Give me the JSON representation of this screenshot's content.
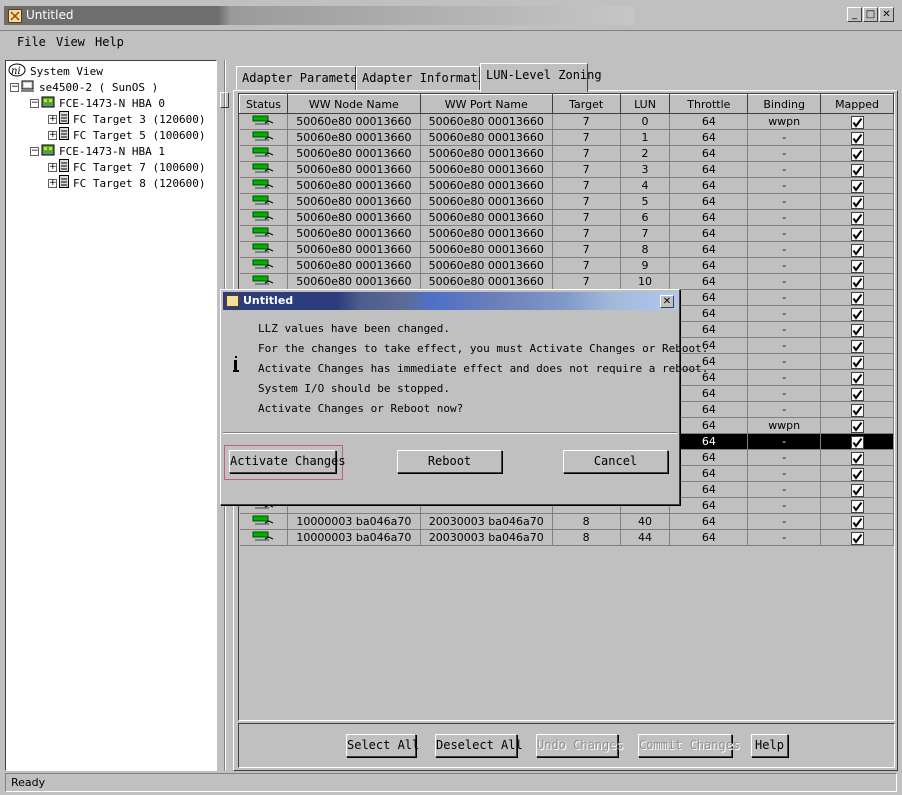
{
  "window": {
    "title": "Untitled"
  },
  "menubar": {
    "items": [
      "File",
      "View",
      "Help"
    ]
  },
  "tree": {
    "root": "System View",
    "host": "se4500-2 ( SunOS )",
    "hba0": "FCE-1473-N HBA 0",
    "hba0_targets": [
      "FC Target 3 (120600)",
      "FC Target 5 (100600)"
    ],
    "hba1": "FCE-1473-N HBA 1",
    "hba1_targets": [
      "FC Target 7 (100600)",
      "FC Target 8 (120600)"
    ]
  },
  "tabs": [
    "Adapter Parameters",
    "Adapter Information",
    "LUN-Level Zoning"
  ],
  "table": {
    "columns": [
      "Status",
      "WW Node Name",
      "WW Port Name",
      "Target",
      "LUN",
      "Throttle",
      "Binding",
      "Mapped"
    ],
    "rows": [
      [
        "",
        "50060e80 00013660",
        "50060e80 00013660",
        "7",
        "0",
        "64",
        "wwpn",
        ""
      ],
      [
        "",
        "50060e80 00013660",
        "50060e80 00013660",
        "7",
        "1",
        "64",
        "-",
        ""
      ],
      [
        "",
        "50060e80 00013660",
        "50060e80 00013660",
        "7",
        "2",
        "64",
        "-",
        ""
      ],
      [
        "",
        "50060e80 00013660",
        "50060e80 00013660",
        "7",
        "3",
        "64",
        "-",
        ""
      ],
      [
        "",
        "50060e80 00013660",
        "50060e80 00013660",
        "7",
        "4",
        "64",
        "-",
        ""
      ],
      [
        "",
        "50060e80 00013660",
        "50060e80 00013660",
        "7",
        "5",
        "64",
        "-",
        ""
      ],
      [
        "",
        "50060e80 00013660",
        "50060e80 00013660",
        "7",
        "6",
        "64",
        "-",
        ""
      ],
      [
        "",
        "50060e80 00013660",
        "50060e80 00013660",
        "7",
        "7",
        "64",
        "-",
        ""
      ],
      [
        "",
        "50060e80 00013660",
        "50060e80 00013660",
        "7",
        "8",
        "64",
        "-",
        ""
      ],
      [
        "",
        "50060e80 00013660",
        "50060e80 00013660",
        "7",
        "9",
        "64",
        "-",
        ""
      ],
      [
        "",
        "50060e80 00013660",
        "50060e80 00013660",
        "7",
        "10",
        "64",
        "-",
        ""
      ],
      [
        "",
        "",
        "",
        "",
        "",
        "64",
        "-",
        ""
      ],
      [
        "",
        "",
        "",
        "",
        "",
        "64",
        "-",
        ""
      ],
      [
        "",
        "",
        "",
        "",
        "",
        "64",
        "-",
        ""
      ],
      [
        "",
        "",
        "",
        "",
        "",
        "64",
        "-",
        ""
      ],
      [
        "",
        "",
        "",
        "",
        "",
        "64",
        "-",
        ""
      ],
      [
        "",
        "",
        "",
        "",
        "",
        "64",
        "-",
        ""
      ],
      [
        "",
        "",
        "",
        "",
        "",
        "64",
        "-",
        ""
      ],
      [
        "",
        "",
        "",
        "",
        "",
        "64",
        "-",
        ""
      ],
      [
        "",
        "",
        "",
        "",
        "",
        "64",
        "wwpn",
        ""
      ],
      [
        "",
        "",
        "",
        "",
        "",
        "64",
        "-",
        ""
      ],
      [
        "",
        "",
        "",
        "",
        "",
        "64",
        "-",
        ""
      ],
      [
        "",
        "",
        "",
        "",
        "",
        "64",
        "-",
        ""
      ],
      [
        "",
        "",
        "",
        "",
        "",
        "64",
        "-",
        ""
      ],
      [
        "",
        "",
        "",
        "",
        "",
        "64",
        "-",
        ""
      ],
      [
        "",
        "10000003 ba046a70",
        "20030003 ba046a70",
        "8",
        "40",
        "64",
        "-",
        ""
      ],
      [
        "",
        "10000003 ba046a70",
        "20030003 ba046a70",
        "8",
        "44",
        "64",
        "-",
        ""
      ]
    ],
    "selected_row": 20
  },
  "buttons": {
    "select_all": "Select All",
    "deselect_all": "Deselect All",
    "undo_changes": "Undo Changes",
    "commit_changes": "Commit Changes",
    "help": "Help"
  },
  "statusbar": {
    "text": "Ready"
  },
  "dialog": {
    "title": "Untitled",
    "lines": [
      "LLZ values have been changed.",
      "For the changes to take effect, you must Activate Changes or Reboot.",
      "Activate Changes has immediate effect and does not require a reboot.",
      "System I/O should be stopped.",
      "Activate Changes or Reboot now?"
    ],
    "activate_label": "Activate Changes",
    "reboot_label": "Reboot",
    "cancel_label": "Cancel"
  },
  "icons": {
    "app": "app-icon",
    "status": "status-ok-icon",
    "mapped": "checkmark-icon",
    "info": "info-icon"
  },
  "colors": {
    "accent_title": "#2c3c7c",
    "selection": "#000000",
    "status_icon": "#00a000"
  }
}
